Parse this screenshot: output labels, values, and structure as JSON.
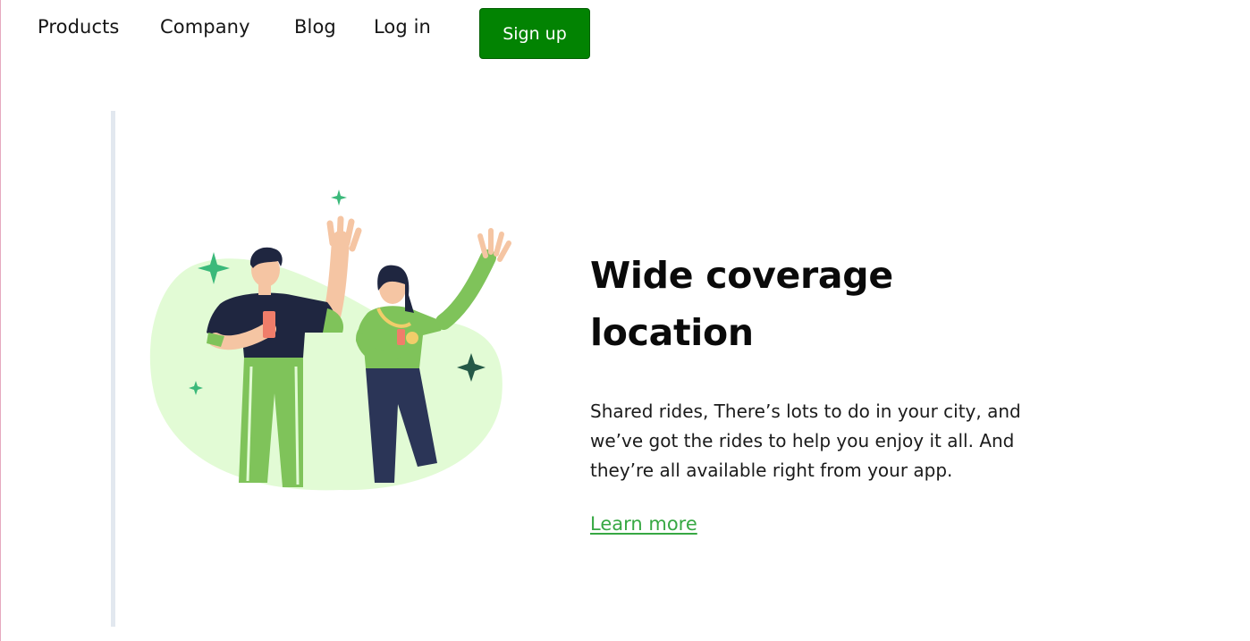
{
  "nav": {
    "links": [
      {
        "label": "Products"
      },
      {
        "label": "Company"
      },
      {
        "label": "Blog"
      },
      {
        "label": "Log in"
      }
    ],
    "signup_label": "Sign up"
  },
  "feature": {
    "title": "Wide coverage location",
    "description": "Shared rides, There’s lots to do in your city, and we’ve got the rides to help you enjoy it all. And they’re all available right from your app.",
    "link_label": "Learn more"
  },
  "colors": {
    "brand_green": "#028302",
    "link_green": "#37a843",
    "illustration_blob": "#e2fbd5"
  },
  "illustration": {
    "icon": "two-people-waving-illustration"
  }
}
